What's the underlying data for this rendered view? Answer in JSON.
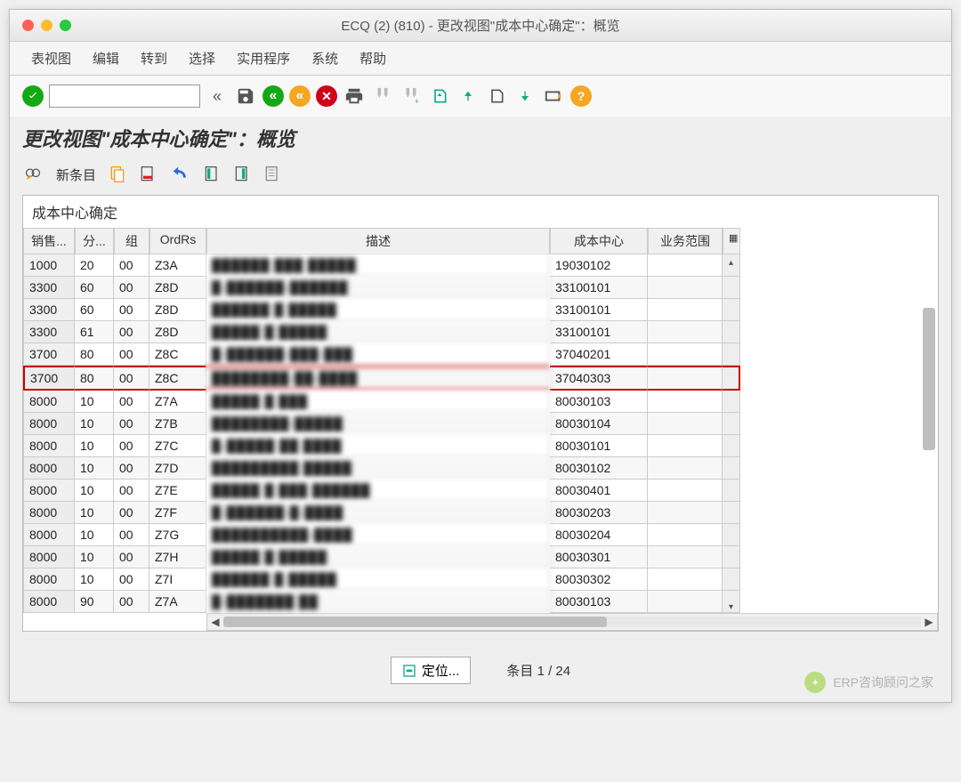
{
  "window": {
    "title": "ECQ (2) (810) - 更改视图\"成本中心确定\"：概览"
  },
  "menu": {
    "items": [
      "表视图",
      "编辑",
      "转到",
      "选择",
      "实用程序",
      "系统",
      "帮助"
    ]
  },
  "section": {
    "title": "更改视图\"成本中心确定\"：概览"
  },
  "toolbar2": {
    "new_entry": "新条目"
  },
  "panel": {
    "title": "成本中心确定"
  },
  "columns": {
    "sales": "销售...",
    "div": "分...",
    "grp": "组",
    "ordrs": "OrdRs",
    "desc": "描述",
    "cost": "成本中心",
    "biz": "业务范围"
  },
  "rows": [
    {
      "sales": "1000",
      "div": "20",
      "grp": "00",
      "ordrs": "Z3A",
      "desc": "██████ ███  █████",
      "cost": "19030102"
    },
    {
      "sales": "3300",
      "div": "60",
      "grp": "00",
      "ordrs": "Z8D",
      "desc": "█-██████-██████",
      "cost": "33100101"
    },
    {
      "sales": "3300",
      "div": "60",
      "grp": "00",
      "ordrs": "Z8D",
      "desc": "██████ █  █████",
      "cost": "33100101"
    },
    {
      "sales": "3300",
      "div": "61",
      "grp": "00",
      "ordrs": "Z8D",
      "desc": "█████ █  █████",
      "cost": "33100101"
    },
    {
      "sales": "3700",
      "div": "80",
      "grp": "00",
      "ordrs": "Z8C",
      "desc": "█-██████-███-███",
      "cost": "37040201"
    },
    {
      "sales": "3700",
      "div": "80",
      "grp": "00",
      "ordrs": "Z8C",
      "desc": "████████-██-████",
      "cost": "37040303",
      "hl": true
    },
    {
      "sales": "8000",
      "div": "10",
      "grp": "00",
      "ordrs": "Z7A",
      "desc": "█████ █  ███",
      "cost": "80030103"
    },
    {
      "sales": "8000",
      "div": "10",
      "grp": "00",
      "ordrs": "Z7B",
      "desc": "████████-█████",
      "cost": "80030104"
    },
    {
      "sales": "8000",
      "div": "10",
      "grp": "00",
      "ordrs": "Z7C",
      "desc": "█-█████ ██  ████",
      "cost": "80030101"
    },
    {
      "sales": "8000",
      "div": "10",
      "grp": "00",
      "ordrs": "Z7D",
      "desc": "█████████ █████",
      "cost": "80030102"
    },
    {
      "sales": "8000",
      "div": "10",
      "grp": "00",
      "ordrs": "Z7E",
      "desc": "█████ █  ███ ██████",
      "cost": "80030401"
    },
    {
      "sales": "8000",
      "div": "10",
      "grp": "00",
      "ordrs": "Z7F",
      "desc": "█-██████-█-████",
      "cost": "80030203"
    },
    {
      "sales": "8000",
      "div": "10",
      "grp": "00",
      "ordrs": "Z7G",
      "desc": "██████████-████",
      "cost": "80030204"
    },
    {
      "sales": "8000",
      "div": "10",
      "grp": "00",
      "ordrs": "Z7H",
      "desc": "█████ █  █████",
      "cost": "80030301"
    },
    {
      "sales": "8000",
      "div": "10",
      "grp": "00",
      "ordrs": "Z7I",
      "desc": "██████ █  █████",
      "cost": "80030302"
    },
    {
      "sales": "8000",
      "div": "90",
      "grp": "00",
      "ordrs": "Z7A",
      "desc": "█-███████  ██",
      "cost": "80030103"
    }
  ],
  "footer": {
    "position": "定位...",
    "entries": "条目 1 / 24"
  },
  "watermark": {
    "text": "ERP咨询顾问之家"
  }
}
